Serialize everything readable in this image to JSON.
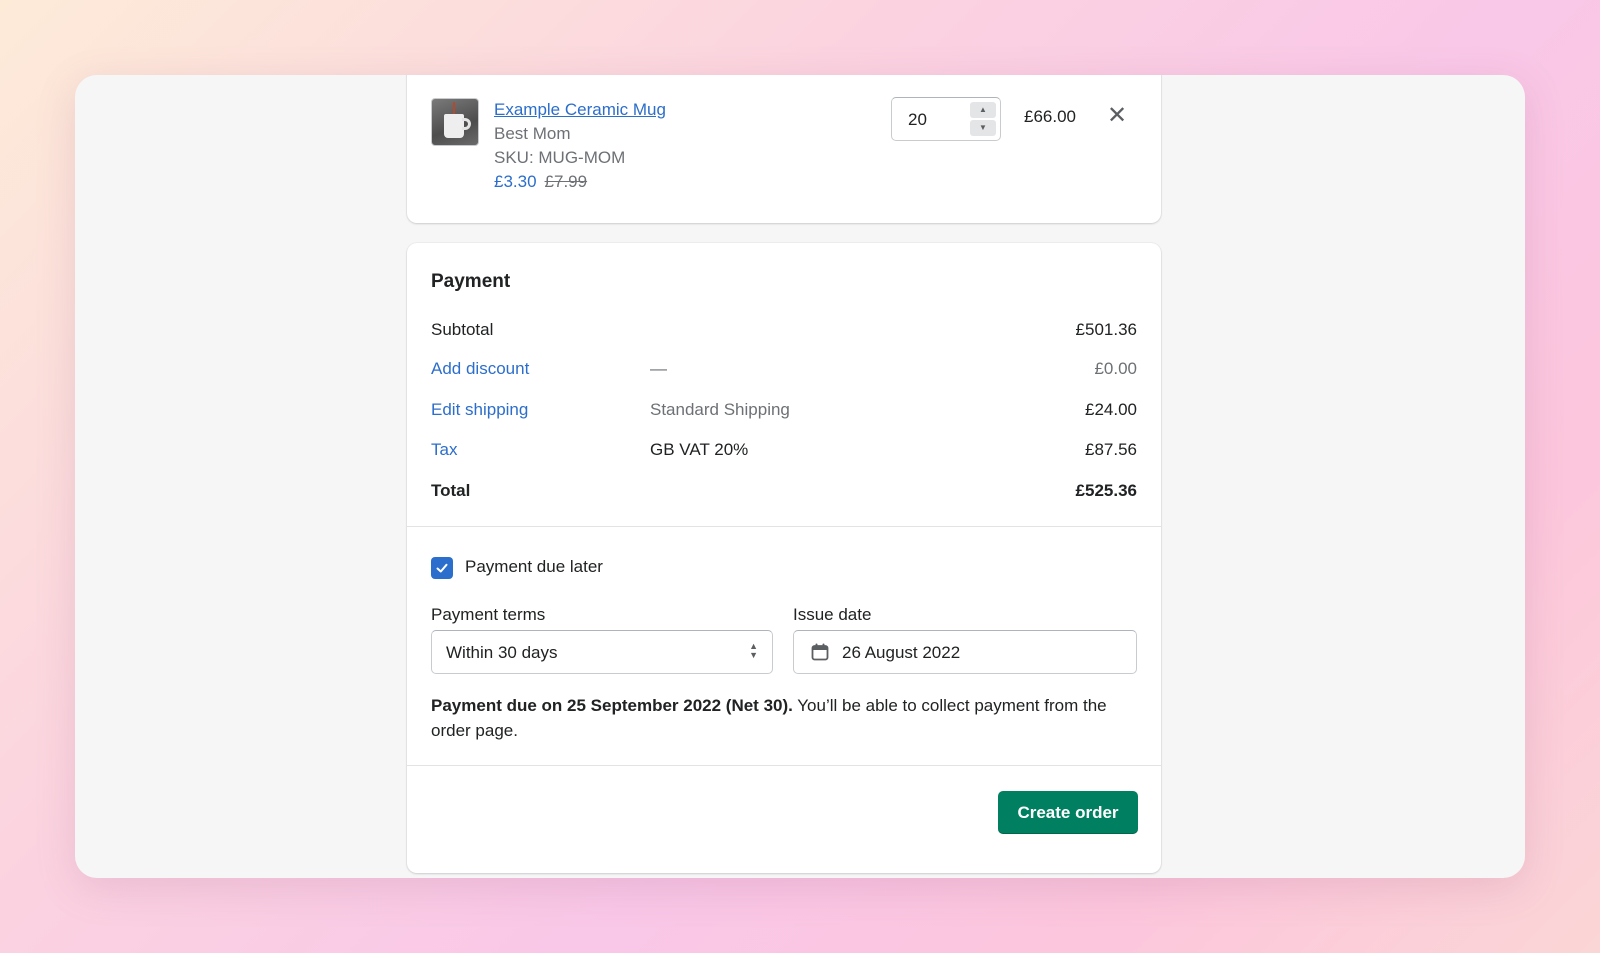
{
  "line_item": {
    "title": "Example Ceramic Mug",
    "variant": "Best Mom",
    "sku": "SKU: MUG-MOM",
    "price": "£3.30",
    "compare_at_price": "£7.99",
    "quantity": "20",
    "total": "£66.00",
    "remove_icon": "close-icon"
  },
  "payment": {
    "title": "Payment",
    "subtotal": {
      "label": "Subtotal",
      "amount": "£501.36"
    },
    "discount": {
      "label": "Add discount",
      "detail": "—",
      "amount": "£0.00"
    },
    "shipping": {
      "label": "Edit shipping",
      "detail": "Standard Shipping",
      "amount": "£24.00"
    },
    "tax": {
      "label": "Tax",
      "detail": "GB VAT 20%",
      "amount": "£87.56"
    },
    "total": {
      "label": "Total",
      "amount": "£525.36"
    }
  },
  "due_later": {
    "checkbox_label": "Payment due later",
    "checked": true,
    "terms_label": "Payment terms",
    "terms_value": "Within 30 days",
    "issue_date_label": "Issue date",
    "issue_date_value": "26 August 2022",
    "note_bold": "Payment due on 25 September 2022 (Net 30).",
    "note_rest": " You’ll be able to collect payment from the order page."
  },
  "actions": {
    "create_label": "Create order"
  },
  "colors": {
    "link": "#2c6ecb",
    "primary_button": "#008060",
    "checkbox": "#2c6ecb"
  }
}
